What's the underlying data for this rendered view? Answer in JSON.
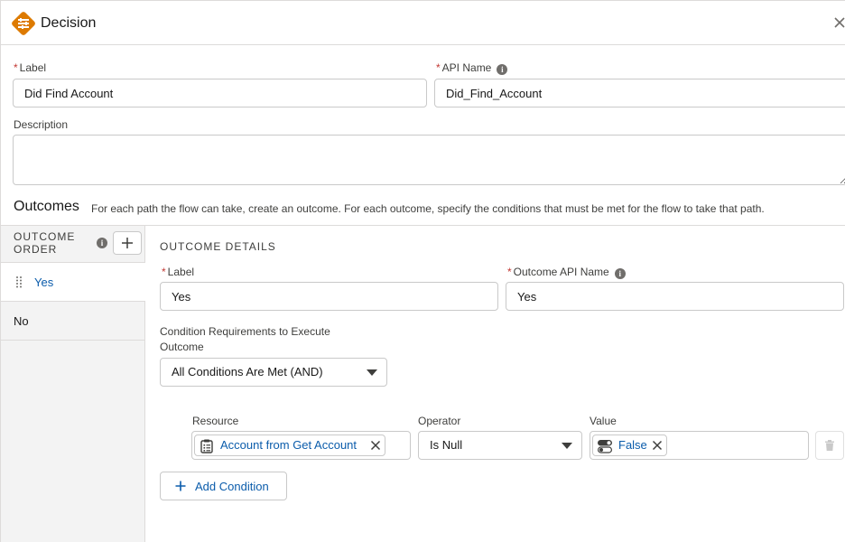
{
  "header": {
    "title": "Decision"
  },
  "label_field": {
    "label": "Label",
    "value": "Did Find Account"
  },
  "api_name_field": {
    "label": "API Name",
    "value": "Did_Find_Account"
  },
  "description_field": {
    "label": "Description",
    "value": ""
  },
  "outcomes": {
    "title": "Outcomes",
    "help": "For each path the flow can take, create an outcome. For each outcome, specify the conditions that must be met for the flow to take that path."
  },
  "sidebar": {
    "order_label": "OUTCOME ORDER",
    "items": [
      {
        "label": "Yes",
        "active": true
      },
      {
        "label": "No",
        "active": false
      }
    ]
  },
  "detail": {
    "heading": "OUTCOME DETAILS",
    "label_field": {
      "label": "Label",
      "value": "Yes"
    },
    "api_name_field": {
      "label": "Outcome API Name",
      "value": "Yes"
    },
    "requirements": {
      "label_line1": "Condition Requirements to Execute",
      "label_line2": "Outcome",
      "selected": "All Conditions Are Met (AND)"
    },
    "condition": {
      "resource_label": "Resource",
      "resource_value": "Account from Get Account",
      "operator_label": "Operator",
      "operator_value": "Is Null",
      "value_label": "Value",
      "value_value": "False"
    },
    "add_condition": "Add Condition"
  },
  "colors": {
    "brand_orange": "#dd7a01",
    "link_blue": "#0b5cab",
    "required_red": "#c23934"
  }
}
